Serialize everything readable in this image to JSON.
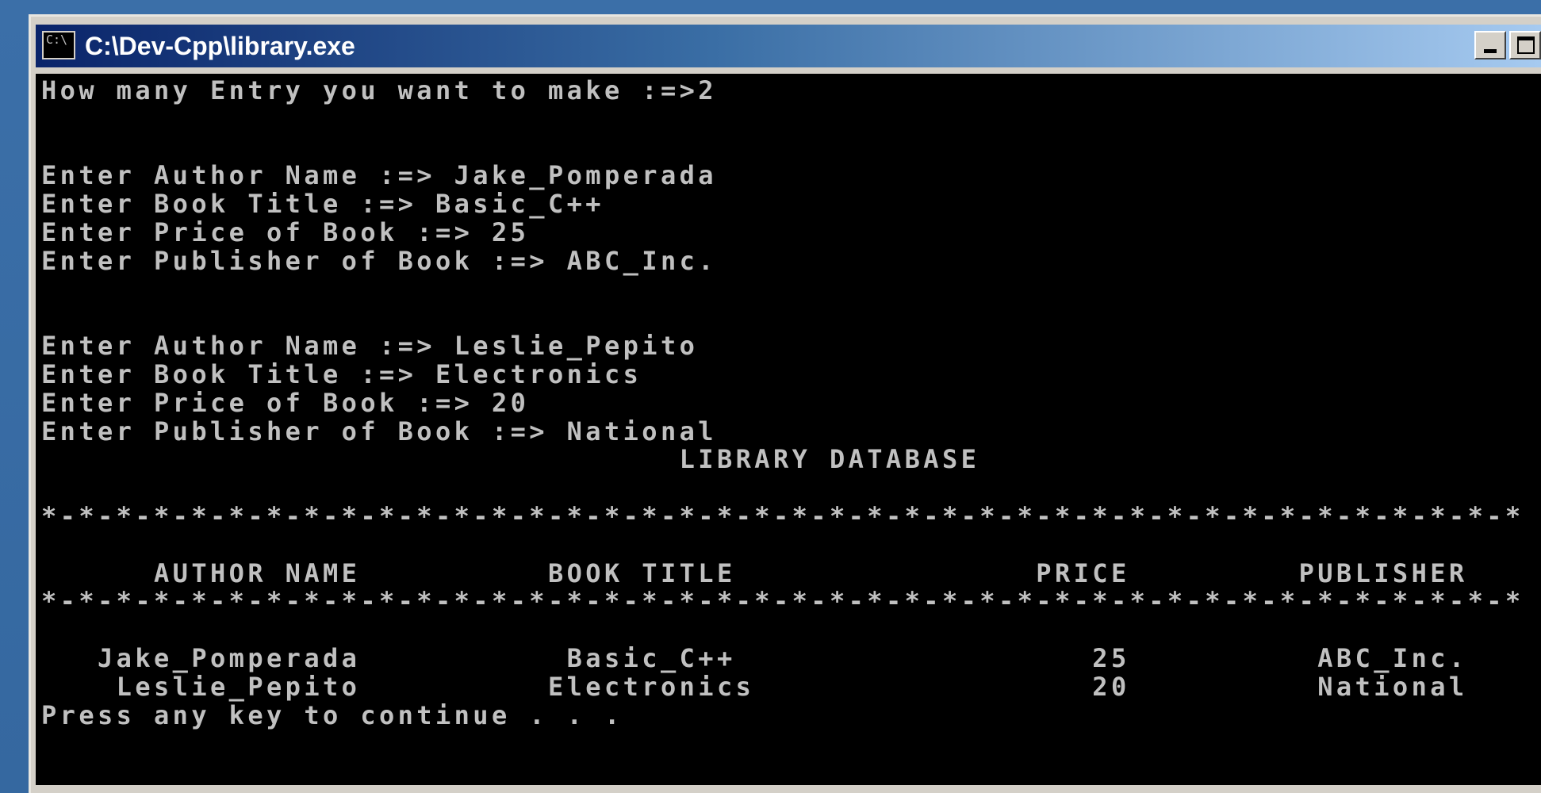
{
  "window": {
    "title": "C:\\Dev-Cpp\\library.exe",
    "icon_text": "C:\\"
  },
  "title_buttons": {
    "minimize_icon": "minimize-icon",
    "maximize_icon": "maximize-icon"
  },
  "console": {
    "lines": [
      "How many Entry you want to make :=>2",
      "",
      "",
      "Enter Author Name :=> Jake_Pomperada",
      "Enter Book Title :=> Basic_C++",
      "Enter Price of Book :=> 25",
      "Enter Publisher of Book :=> ABC_Inc.",
      "",
      "",
      "Enter Author Name :=> Leslie_Pepito",
      "Enter Book Title :=> Electronics",
      "Enter Price of Book :=> 20",
      "Enter Publisher of Book :=> National",
      "                                  LIBRARY DATABASE",
      "",
      "*-*-*-*-*-*-*-*-*-*-*-*-*-*-*-*-*-*-*-*-*-*-*-*-*-*-*-*-*-*-*-*-*-*-*-*-*-*-*-*",
      "",
      "      AUTHOR NAME          BOOK TITLE                PRICE         PUBLISHER",
      "*-*-*-*-*-*-*-*-*-*-*-*-*-*-*-*-*-*-*-*-*-*-*-*-*-*-*-*-*-*-*-*-*-*-*-*-*-*-*-*",
      "",
      "   Jake_Pomperada           Basic_C++                   25          ABC_Inc.",
      "    Leslie_Pepito          Electronics                  20          National",
      "Press any key to continue . . ."
    ]
  }
}
